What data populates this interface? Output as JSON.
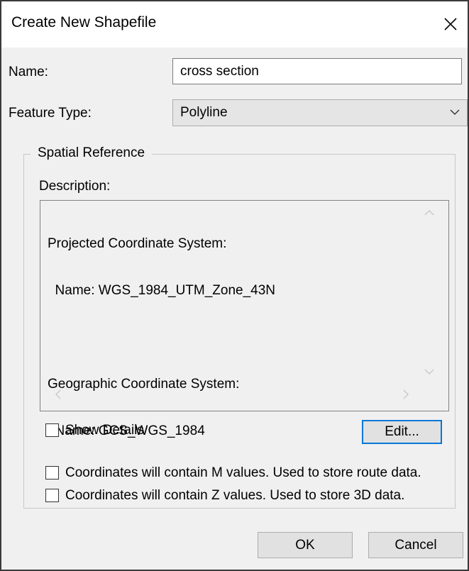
{
  "dialog": {
    "title": "Create New Shapefile",
    "close_icon": "close-icon"
  },
  "name": {
    "label": "Name:",
    "value": "cross section"
  },
  "feature_type": {
    "label": "Feature Type:",
    "selected": "Polyline",
    "arrow_icon": "chevron-down-icon"
  },
  "spatial_reference": {
    "group_label": "Spatial Reference",
    "description_label": "Description:",
    "lines": [
      "Projected Coordinate System:",
      "  Name: WGS_1984_UTM_Zone_43N",
      "",
      "Geographic Coordinate System:",
      "  Name: GCS_WGS_1984"
    ],
    "show_details_label": "Show Details",
    "show_details_checked": false,
    "edit_label": "Edit..."
  },
  "options": {
    "m_values_label": "Coordinates will contain M values. Used to store route data.",
    "m_values_checked": false,
    "z_values_label": "Coordinates will contain Z values. Used to store 3D data.",
    "z_values_checked": false
  },
  "buttons": {
    "ok": "OK",
    "cancel": "Cancel"
  }
}
